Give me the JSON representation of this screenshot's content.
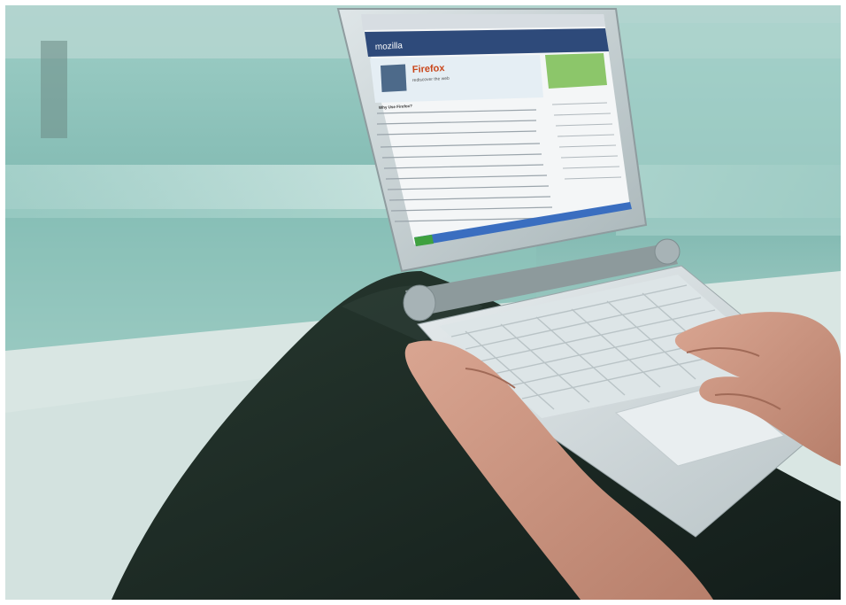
{
  "photo": {
    "subject": "laptop-on-lap",
    "colors": {
      "background_teal": "#7fb8b0",
      "background_light": "#cfe8e3",
      "floor": "#d9e6e3",
      "trousers": "#1c2a27",
      "laptop_body": "#c9d3d6",
      "laptop_hinge": "#8d9a9c",
      "keyboard": "#e6ecee",
      "skin": "#c9917c",
      "browser_header": "#2e4a7a"
    }
  },
  "screen": {
    "brand": "mozilla",
    "product": "Firefox",
    "tagline": "rediscover the web",
    "section_heading": "Why Use Firefox?"
  }
}
